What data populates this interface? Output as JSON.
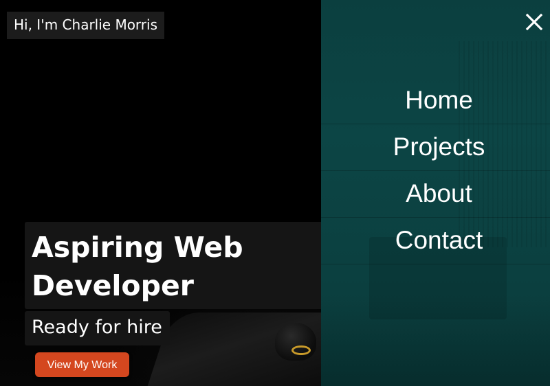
{
  "hero": {
    "greeting": "Hi, I'm Charlie Morris",
    "headline": "Aspiring Web Developer",
    "subheadline": "Ready for hire",
    "cta_label": "View My Work"
  },
  "nav": {
    "close_icon": "close-icon",
    "items": [
      {
        "label": "Home"
      },
      {
        "label": "Projects"
      },
      {
        "label": "About"
      },
      {
        "label": "Contact"
      }
    ]
  },
  "colors": {
    "nav_background": "#0c4545",
    "cta_background": "#d4471f",
    "text": "#ffffff"
  }
}
